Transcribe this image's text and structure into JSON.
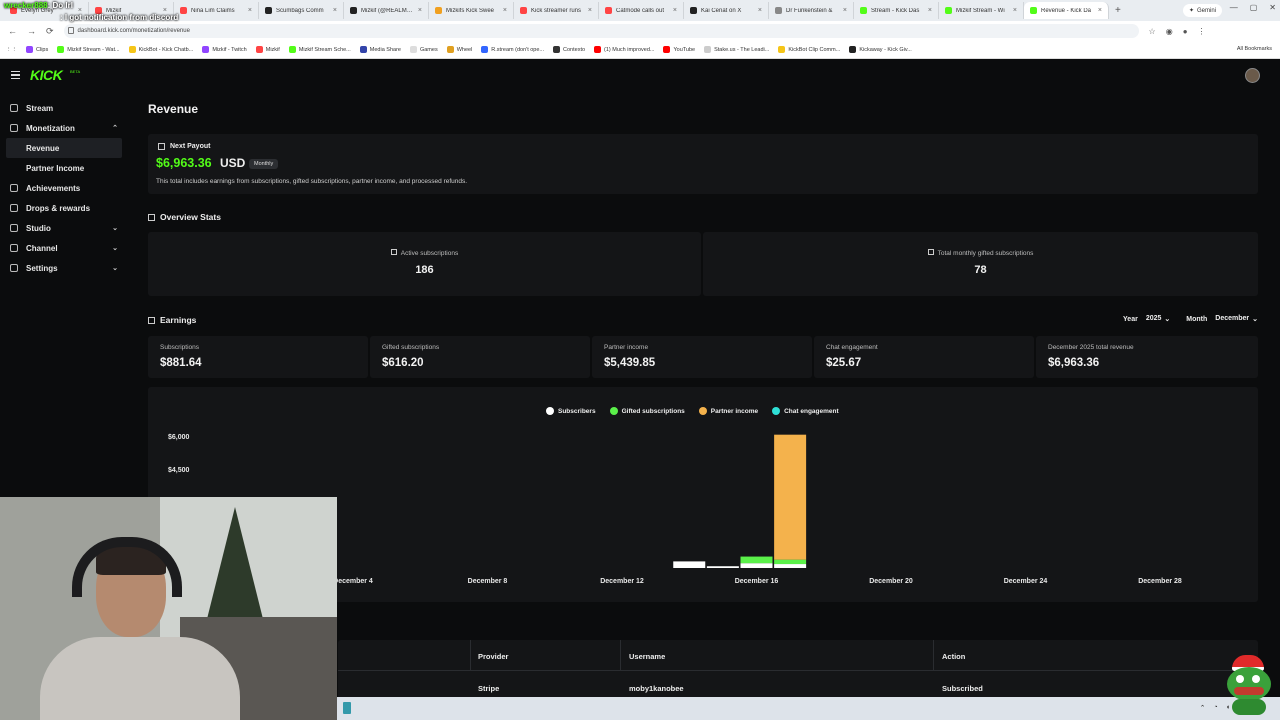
{
  "browser": {
    "tabs": [
      {
        "title": "Evelyn Grey",
        "color": "#ff4444"
      },
      {
        "title": "Mizkif",
        "color": "#ff4444"
      },
      {
        "title": "Nina Lim Claims",
        "color": "#ff4444"
      },
      {
        "title": "Scumbags Comm",
        "color": "#222222"
      },
      {
        "title": "Mizkif (@REALMizk",
        "color": "#222222"
      },
      {
        "title": "Mizkifs Kick Swee",
        "color": "#f0a020"
      },
      {
        "title": "Kick streamer runs",
        "color": "#ff4444"
      },
      {
        "title": "Catmode calls out",
        "color": "#ff4444"
      },
      {
        "title": "Kai Cenat on X",
        "color": "#222222"
      },
      {
        "title": "Dr Funkenstein &",
        "color": "#888888"
      },
      {
        "title": "Stream - Kick Das",
        "color": "#53fc18"
      },
      {
        "title": "Mizkif Stream - Wi",
        "color": "#53fc18"
      },
      {
        "title": "Revenue - Kick Da",
        "color": "#53fc18",
        "active": true
      }
    ],
    "gemini_label": "Gemini",
    "url": "dashboard.kick.com/monetization/revenue",
    "bookmarks": [
      {
        "label": "Clips",
        "color": "#9146ff"
      },
      {
        "label": "Mizkif Stream - Wat...",
        "color": "#53fc18"
      },
      {
        "label": "KickBot - Kick Chatb...",
        "color": "#f5c518"
      },
      {
        "label": "Mizkif - Twitch",
        "color": "#9146ff"
      },
      {
        "label": "Mizkif",
        "color": "#ff4444"
      },
      {
        "label": "Mizkif Stream Sche...",
        "color": "#53fc18"
      },
      {
        "label": "Media Share",
        "color": "#3344aa"
      },
      {
        "label": "Games",
        "color": "#dddddd"
      },
      {
        "label": "Wheel",
        "color": "#e0a020"
      },
      {
        "label": "R.stream (don't ope...",
        "color": "#3366ff"
      },
      {
        "label": "Contexto",
        "color": "#333333"
      },
      {
        "label": "(1) Much improved...",
        "color": "#ff0000"
      },
      {
        "label": "YouTube",
        "color": "#ff0000"
      },
      {
        "label": "Stake.us - The Leadi...",
        "color": "#cccccc"
      },
      {
        "label": "KickBot Clip Comm...",
        "color": "#f5c518"
      },
      {
        "label": "Kickaway - Kick Giv...",
        "color": "#222222"
      }
    ],
    "all_bookmarks": "All Bookmarks"
  },
  "stream_overlay": {
    "username": "wrecker888",
    "msg1": ": Do lrl",
    "msg2": ": I got notification from discord"
  },
  "app": {
    "logo": "KICK",
    "logo_badge": "BETA"
  },
  "sidebar": {
    "items": [
      {
        "label": "Stream"
      },
      {
        "label": "Monetization",
        "chevron": "up"
      },
      {
        "label": "Revenue",
        "sub": true,
        "active": true
      },
      {
        "label": "Partner Income",
        "sub": true
      },
      {
        "label": "Achievements"
      },
      {
        "label": "Drops & rewards"
      },
      {
        "label": "Studio",
        "chevron": "down"
      },
      {
        "label": "Channel",
        "chevron": "down"
      },
      {
        "label": "Settings",
        "chevron": "down"
      }
    ]
  },
  "page": {
    "title": "Revenue",
    "payout": {
      "header": "Next Payout",
      "amount": "$6,963.36",
      "currency": "USD",
      "frequency": "Monthly",
      "note": "This total includes earnings from subscriptions, gifted subscriptions, partner income, and processed refunds."
    },
    "overview": {
      "title": "Overview Stats",
      "stats": [
        {
          "label": "Active subscriptions",
          "value": "186"
        },
        {
          "label": "Total monthly gifted subscriptions",
          "value": "78"
        }
      ]
    },
    "earnings": {
      "title": "Earnings",
      "year_label": "Year",
      "year_value": "2025",
      "month_label": "Month",
      "month_value": "December",
      "cards": [
        {
          "label": "Subscriptions",
          "value": "$881.64"
        },
        {
          "label": "Gifted subscriptions",
          "value": "$616.20"
        },
        {
          "label": "Partner income",
          "value": "$5,439.85"
        },
        {
          "label": "Chat engagement",
          "value": "$25.67"
        },
        {
          "label": "December 2025 total revenue",
          "value": "$6,963.36"
        }
      ]
    },
    "table": {
      "headers": [
        "Provider",
        "Username",
        "Action"
      ],
      "rows": [
        [
          "Stripe",
          "moby1kanobee",
          "Subscribed"
        ]
      ]
    }
  },
  "chart_data": {
    "type": "bar",
    "stacked": true,
    "x_tick_labels": [
      "December 4",
      "December 8",
      "December 12",
      "December 16",
      "December 20",
      "December 24",
      "December 28"
    ],
    "y_tick_labels": [
      "$6,000",
      "$4,500"
    ],
    "y_ticks": [
      6000,
      4500
    ],
    "ylim": [
      0,
      6000
    ],
    "legend_placement": "top-center",
    "categories": [
      "December 14",
      "December 15",
      "December 16",
      "December 17"
    ],
    "series": [
      {
        "name": "Subscribers",
        "color": "#ffffff",
        "values": [
          300,
          80,
          220,
          180
        ]
      },
      {
        "name": "Gifted subscriptions",
        "color": "#5bf04a",
        "values": [
          0,
          0,
          300,
          200
        ]
      },
      {
        "name": "Partner income",
        "color": "#f4b24c",
        "values": [
          0,
          0,
          0,
          5680
        ]
      },
      {
        "name": "Chat engagement",
        "color": "#2fe0d7",
        "values": [
          0,
          0,
          0,
          0
        ]
      }
    ]
  },
  "colors": {
    "accent": "#53fc18",
    "background": "#0b0c0d",
    "card": "#141517"
  }
}
